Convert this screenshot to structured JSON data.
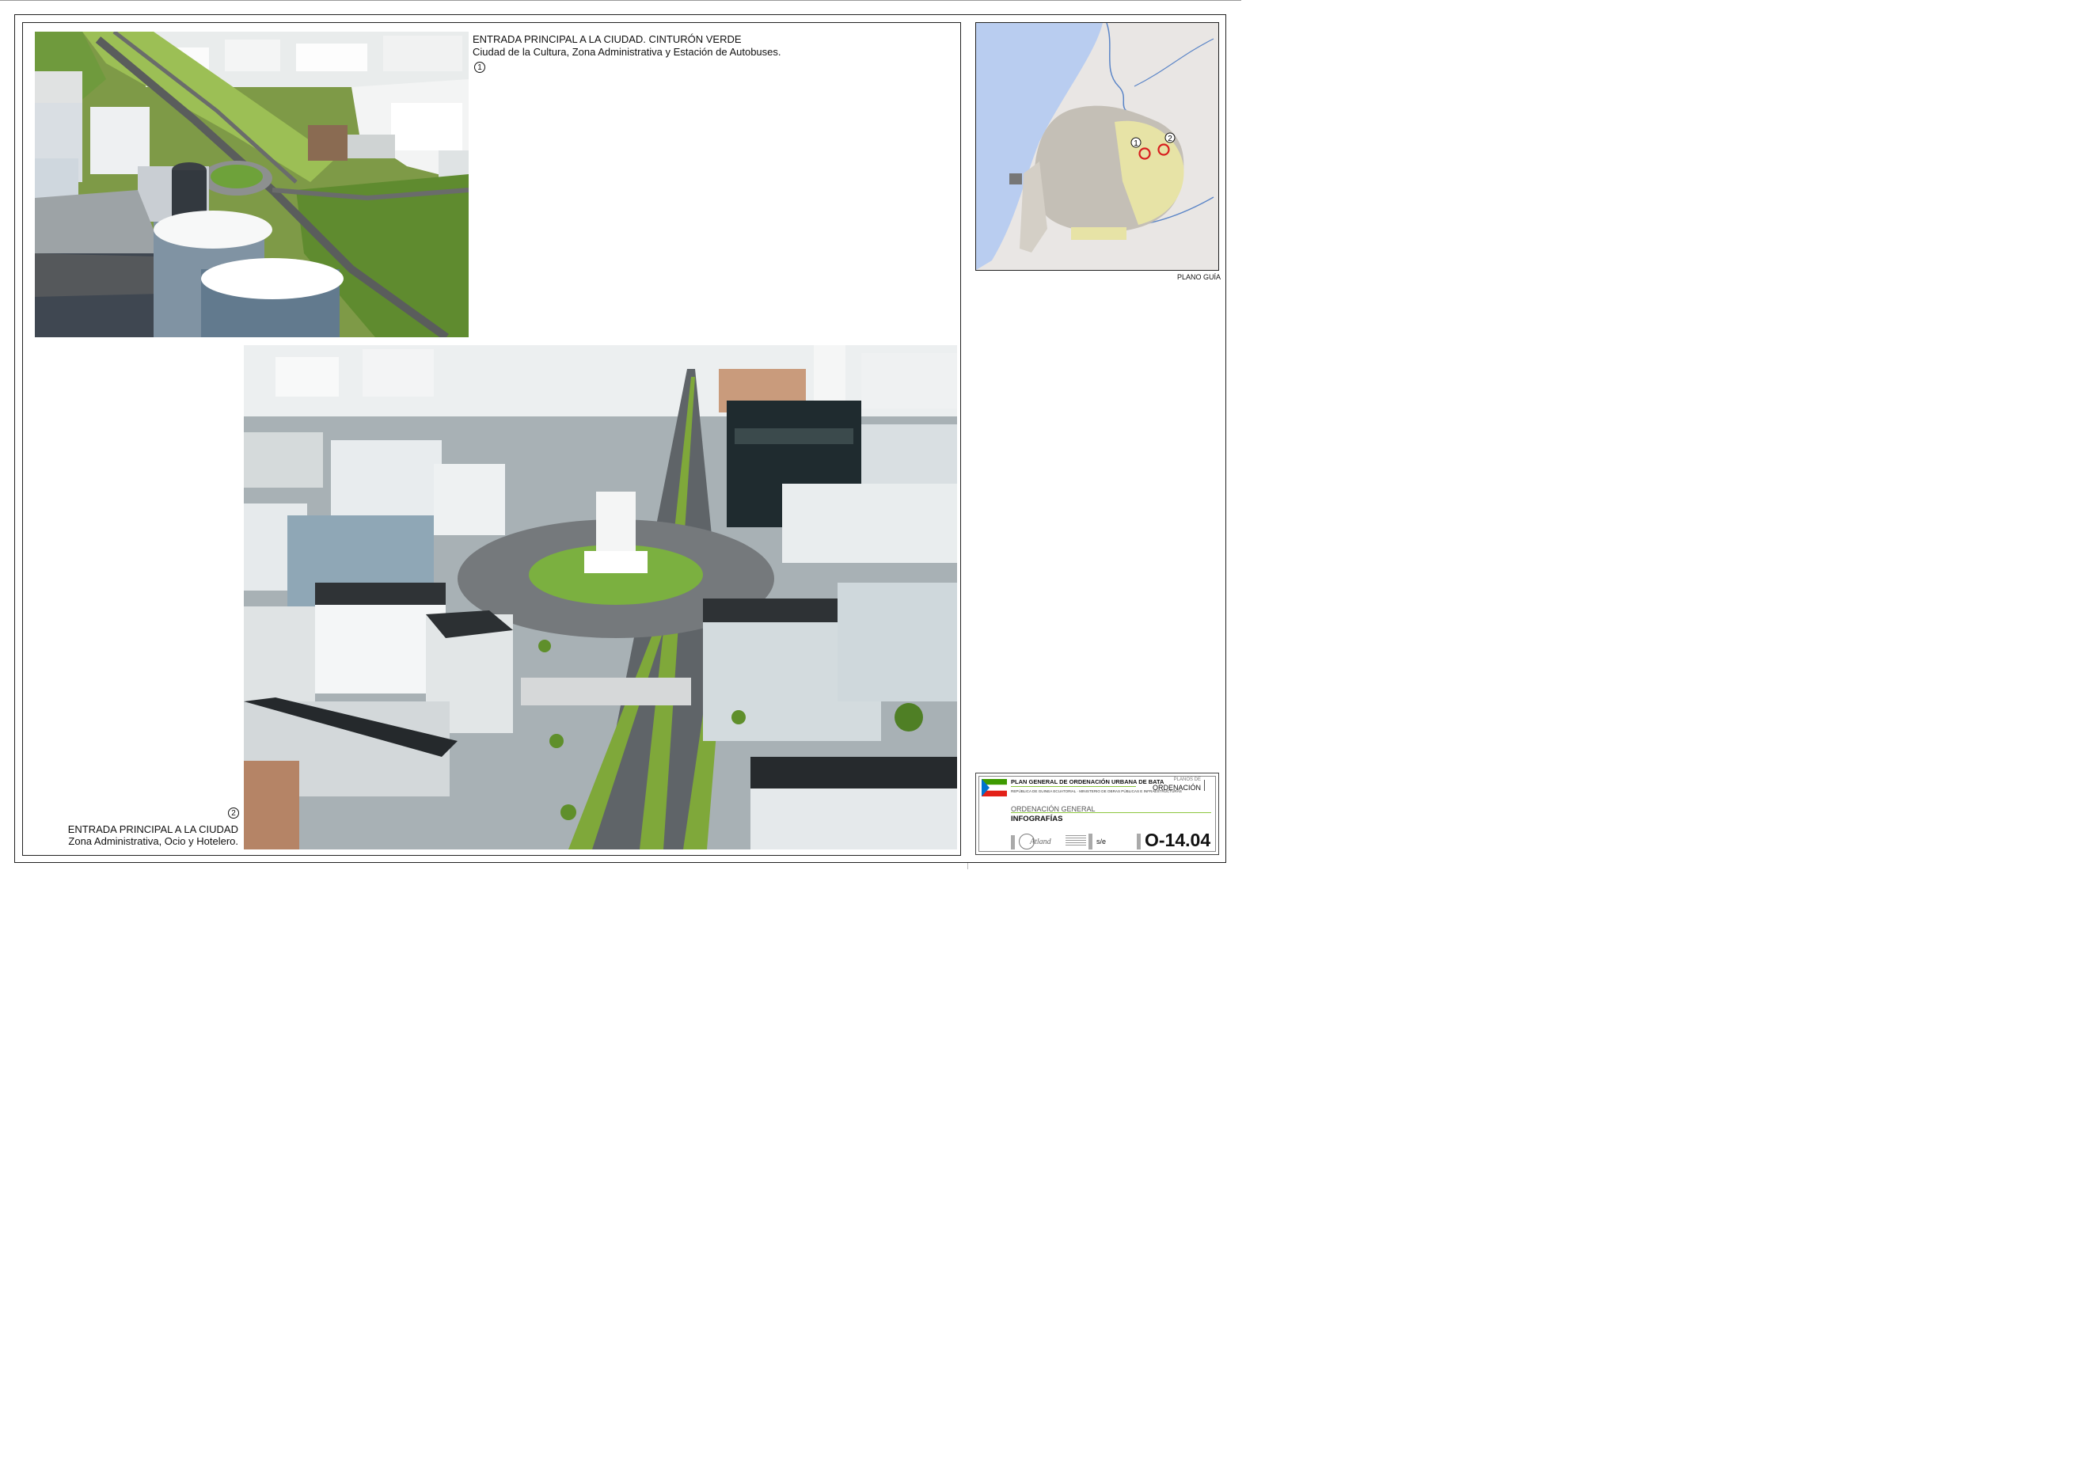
{
  "image1": {
    "title": "ENTRADA PRINCIPAL A LA CIUDAD. CINTURÓN VERDE",
    "subtitle": "Ciudad de la Cultura, Zona Administrativa y Estación de Autobuses.",
    "number": "1"
  },
  "image2": {
    "title": "ENTRADA PRINCIPAL A LA CIUDAD",
    "subtitle": "Zona Administrativa, Ocio y Hotelero.",
    "number": "2"
  },
  "map": {
    "caption": "PLANO GUÍA",
    "marker1": "1",
    "marker2": "2",
    "marker_color": "#d81e1e",
    "sea_color": "#b9cdf0"
  },
  "title_block": {
    "plan_title": "PLAN GENERAL DE ORDENACIÓN URBANA DE BATA",
    "ministry": "REPÚBLICA DE GUINEA ECUATORIAL · MINISTERIO DE OBRAS PÚBLICAS E INFRAESTRUCTURAS",
    "plans_label": "PLANOS DE",
    "plans_value": "ORDENACIÓN",
    "section": "ORDENACIÓN GENERAL",
    "subject": "INFOGRAFÍAS",
    "company": "Atland",
    "scale": "s/e",
    "plan_code": "O-14.04",
    "accent_color": "#8cc63f"
  }
}
